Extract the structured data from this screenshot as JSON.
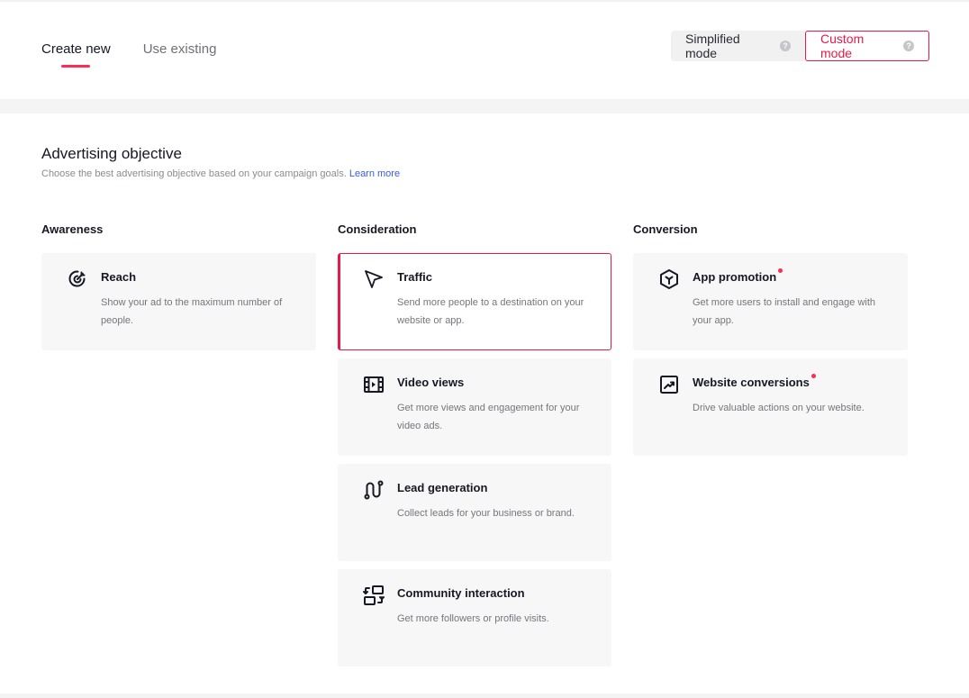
{
  "tabs": [
    {
      "label": "Create new",
      "active": true
    },
    {
      "label": "Use existing",
      "active": false
    }
  ],
  "mode_switch": {
    "simplified_label": "Simplified mode",
    "custom_label": "Custom mode",
    "selected": "custom",
    "help_glyph": "?"
  },
  "objective": {
    "title": "Advertising objective",
    "subtitle": "Choose the best advertising objective based on your campaign goals.",
    "learn_more": "Learn more"
  },
  "columns": [
    {
      "title": "Awareness",
      "items": [
        {
          "title": "Reach",
          "description": "Show your ad to the maximum number of people.",
          "icon": "target-icon",
          "selected": false,
          "new_dot": false
        }
      ]
    },
    {
      "title": "Consideration",
      "items": [
        {
          "title": "Traffic",
          "description": "Send more people to a destination on your website or app.",
          "icon": "cursor-arrow-icon",
          "selected": true,
          "new_dot": false
        },
        {
          "title": "Video views",
          "description": "Get more views and engagement for your video ads.",
          "icon": "film-play-icon",
          "selected": false,
          "new_dot": false
        },
        {
          "title": "Lead generation",
          "description": "Collect leads for your business or brand.",
          "icon": "route-icon",
          "selected": false,
          "new_dot": false
        },
        {
          "title": "Community interaction",
          "description": "Get more followers or profile visits.",
          "icon": "swap-squares-icon",
          "selected": false,
          "new_dot": false
        }
      ]
    },
    {
      "title": "Conversion",
      "items": [
        {
          "title": "App promotion",
          "description": "Get more users to install and engage with your app.",
          "icon": "hexagon-app-icon",
          "selected": false,
          "new_dot": true
        },
        {
          "title": "Website conversions",
          "description": "Drive valuable actions on your website.",
          "icon": "trend-chart-icon",
          "selected": false,
          "new_dot": true
        }
      ]
    }
  ],
  "colors": {
    "accent": "#fe2c55",
    "selected_border": "#e8194a",
    "link": "#3b5bdb",
    "card_bg": "#f7f7f8"
  }
}
